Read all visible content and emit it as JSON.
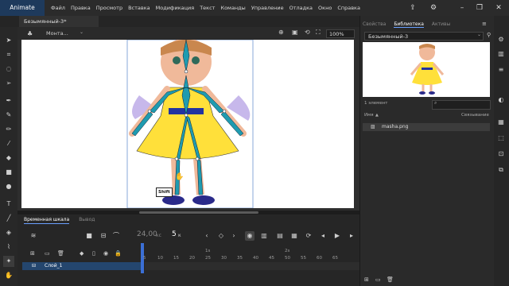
{
  "app": {
    "name": "Animate"
  },
  "menu": [
    "Файл",
    "Правка",
    "Просмотр",
    "Вставка",
    "Модификация",
    "Текст",
    "Команды",
    "Управление",
    "Отладка",
    "Окно",
    "Справка"
  ],
  "document": {
    "tab_title": "Безымянный-3*"
  },
  "editbar": {
    "scene": "Монта...",
    "zoom": "100%"
  },
  "stage": {
    "tooltip": "Shift"
  },
  "timeline": {
    "tabs": [
      "Временная шкала",
      "Вывод"
    ],
    "fps": "24,00",
    "fps_unit": "кс",
    "current_frame": "5",
    "frame_unit": "к",
    "section_markers": [
      "1s",
      "2s"
    ],
    "ticks": [
      "5",
      "10",
      "15",
      "20",
      "25",
      "30",
      "35",
      "40",
      "45",
      "50",
      "55",
      "60",
      "65"
    ],
    "layer_name": "Слой_1"
  },
  "library": {
    "tabs": [
      "Свойства",
      "Библиотека",
      "Активы"
    ],
    "document_select": "Безымянный-3",
    "item_count": "1 элемент",
    "col_name": "Имя",
    "col_link": "Связывание",
    "items": [
      {
        "name": "masha.png"
      }
    ]
  }
}
